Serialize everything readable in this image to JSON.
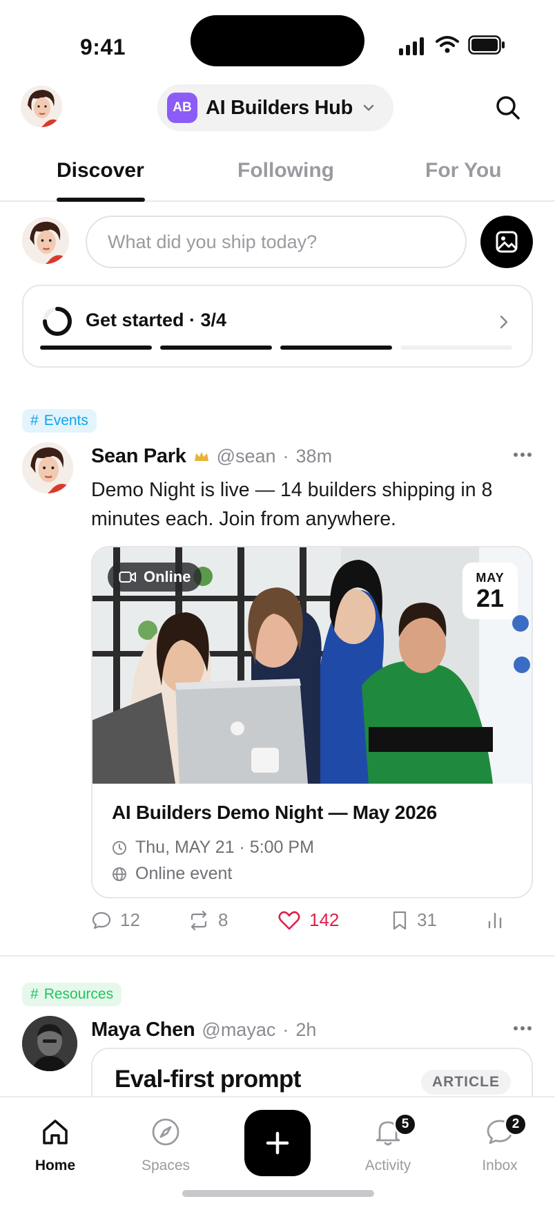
{
  "status_bar": {
    "time": "9:41"
  },
  "header": {
    "hub_logo_text": "AB",
    "hub_name": "AI Builders Hub"
  },
  "tabs": [
    {
      "label": "Discover",
      "active": true
    },
    {
      "label": "Following",
      "active": false
    },
    {
      "label": "For You",
      "active": false
    }
  ],
  "composer": {
    "placeholder": "What did you ship today?"
  },
  "get_started": {
    "label": "Get started · 3/4",
    "completed": 3,
    "total": 4
  },
  "posts": [
    {
      "tag": "Events",
      "tag_color": "#0ea5e9",
      "author": "Sean Park",
      "handle": "@sean",
      "time": "38m",
      "text": "Demo Night is live — 14 builders shipping in 8 minutes each. Join from anywhere.",
      "event": {
        "mode_label": "Online",
        "month": "MAY",
        "day": "21",
        "title": "AI Builders Demo Night — May 2026",
        "datetime": "Thu, MAY 21 · 5:00 PM",
        "location": "Online event"
      },
      "stats": {
        "comments": "12",
        "reposts": "8",
        "likes": "142",
        "bookmarks": "31"
      }
    },
    {
      "tag": "Resources",
      "tag_color": "#22c55e",
      "author": "Maya Chen",
      "handle": "@mayac",
      "time": "2h",
      "article_title": "Eval-first prompt",
      "article_badge": "ARTICLE"
    }
  ],
  "bottom_nav": {
    "items": [
      {
        "label": "Home",
        "icon": "home-icon",
        "active": true
      },
      {
        "label": "Spaces",
        "icon": "compass-icon"
      },
      {
        "label": "Activity",
        "icon": "bell-icon",
        "badge": "5"
      },
      {
        "label": "Inbox",
        "icon": "chat-bubble-icon",
        "badge": "2"
      }
    ]
  },
  "colors": {
    "accent": "#111111",
    "like": "#e11d48",
    "hub_logo": "#8b5cf6"
  }
}
